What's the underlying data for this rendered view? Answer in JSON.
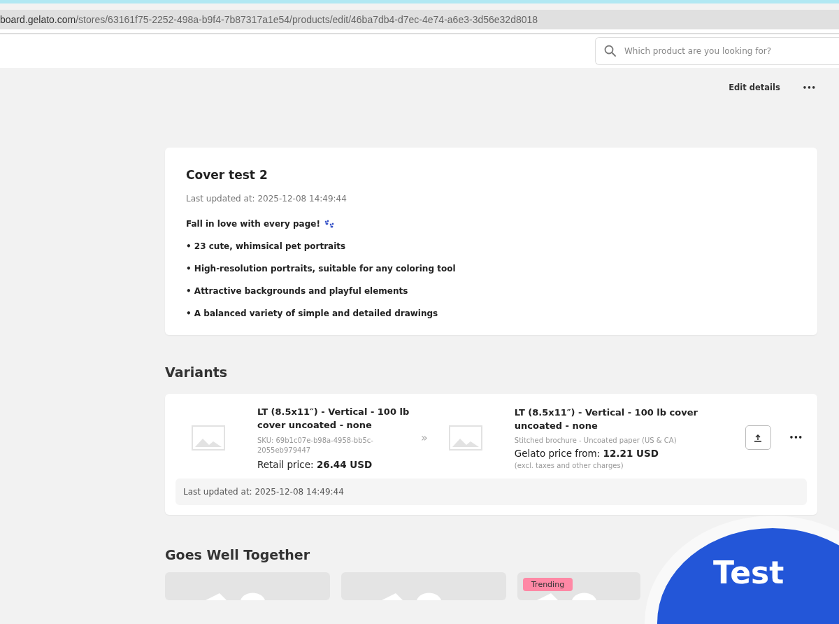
{
  "browser": {
    "url_domain": "board.gelato.com",
    "url_path": "/stores/63161f75-2252-498a-b9f4-7b87317a1e54/products/edit/46ba7db4-d7ec-4e74-a6e3-3d56e32d8018"
  },
  "search": {
    "placeholder": "Which product are you looking for?"
  },
  "actions": {
    "edit": "Edit details",
    "more": "•••"
  },
  "product": {
    "title": "Cover test 2",
    "updated": "Last updated at: 2025-12-08 14:49:44",
    "intro": "Fall in love with every page!",
    "bullets": [
      "• 23 cute, whimsical pet portraits",
      "• High-resolution portraits, suitable for any coloring tool",
      "• Attractive backgrounds and playful elements",
      "• A balanced variety of simple and detailed drawings"
    ]
  },
  "variants": {
    "heading": "Variants",
    "items": [
      {
        "name": "LT (8.5x11″) - Vertical - 100 lb cover uncoated - none",
        "sku": "SKU: 69b1c07e-b98a-4958-bb5c-2055eb979447",
        "retail": "Retail price: **26.44 USD**",
        "link": "»",
        "gelato_name": "LT (8.5x11″) - Vertical - 100 lb cover uncoated - none",
        "gelato_type": "Stitched brochure - Uncoated paper (US & CA)",
        "gelato_price": "Gelato price from: **12.21 USD**",
        "note": "(excl. taxes and other charges)",
        "more": "•••",
        "updated": "Last updated at: 2025-12-08 14:49:44"
      }
    ]
  },
  "related": {
    "heading": "Goes Well Together",
    "cards": [
      {
        "kind": "product"
      },
      {
        "kind": "product"
      },
      {
        "kind": "trending",
        "badge": "Trending"
      }
    ]
  },
  "overlay": {
    "label": "Test"
  }
}
